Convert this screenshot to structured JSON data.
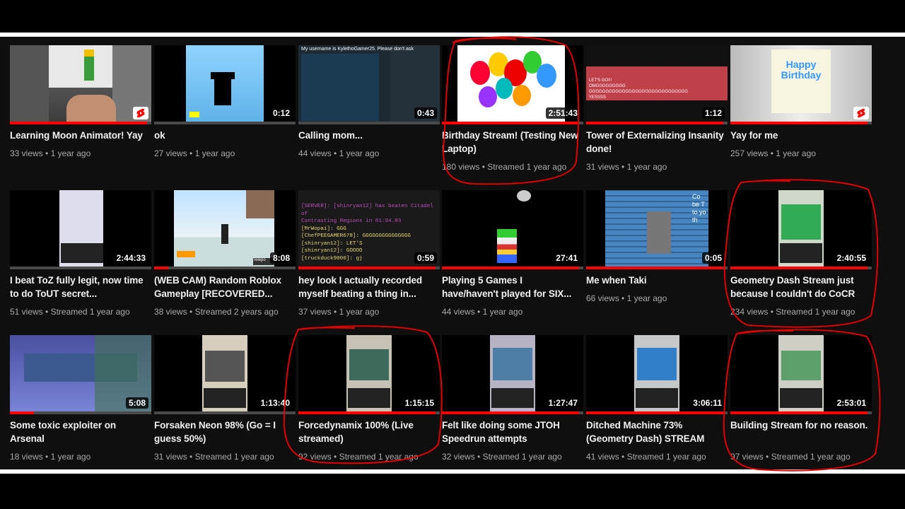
{
  "colors": {
    "accent": "#ff0000",
    "annotation": "#e00000",
    "background": "#0f0f0f"
  },
  "videos": [
    {
      "title": "Learning Moon Animator! Yay",
      "views": "33 views",
      "date": "1 year ago",
      "duration": "",
      "short": true,
      "progress": 0.97
    },
    {
      "title": "ok",
      "views": "27 views",
      "date": "1 year ago",
      "duration": "0:12",
      "short": false,
      "progress": 0.0
    },
    {
      "title": "Calling mom...",
      "views": "44 views",
      "date": "1 year ago",
      "duration": "0:43",
      "short": false,
      "progress": 0.0
    },
    {
      "title": "Birthday Stream! (Testing New Laptop)",
      "views": "180 views",
      "date": "Streamed 1 year ago",
      "duration": "2:51:43",
      "short": false,
      "progress": 0.97
    },
    {
      "title": "Tower of Externalizing Insanity done!",
      "views": "31 views",
      "date": "1 year ago",
      "duration": "1:12",
      "short": false,
      "progress": 0.97
    },
    {
      "title": "Yay for me",
      "views": "257 views",
      "date": "1 year ago",
      "duration": "",
      "short": true,
      "progress": 0.97
    },
    {
      "title": "I beat ToZ fully legit, now time to do ToUT secret...",
      "views": "51 views",
      "date": "Streamed 1 year ago",
      "duration": "2:44:33",
      "short": false,
      "progress": 0.0
    },
    {
      "title": "(WEB CAM) Random Roblox Gameplay [RECOVERED...",
      "views": "38 views",
      "date": "Streamed 2 years ago",
      "duration": "8:08",
      "short": false,
      "progress": 0.1
    },
    {
      "title": "hey look I actually recorded myself beating a thing in...",
      "views": "37 views",
      "date": "1 year ago",
      "duration": "0:59",
      "short": false,
      "progress": 0.97
    },
    {
      "title": "Playing 5 Games I have/haven't played for SIX...",
      "views": "44 views",
      "date": "1 year ago",
      "duration": "27:41",
      "short": false,
      "progress": 0.97
    },
    {
      "title": "Me when Taki",
      "views": "66 views",
      "date": "1 year ago",
      "duration": "0:05",
      "short": false,
      "progress": 0.97
    },
    {
      "title": "Geometry Dash Stream just because I couldn't do CoCR",
      "views": "234 views",
      "date": "Streamed 1 year ago",
      "duration": "2:40:55",
      "short": false,
      "progress": 0.97
    },
    {
      "title": "Some toxic exploiter on Arsenal",
      "views": "18 views",
      "date": "1 year ago",
      "duration": "5:08",
      "short": false,
      "progress": 0.17
    },
    {
      "title": "Forsaken Neon 98% (Go = I guess 50%)",
      "views": "31 views",
      "date": "Streamed 1 year ago",
      "duration": "1:13:40",
      "short": false,
      "progress": 0.0
    },
    {
      "title": "Forcedynamix 100% (Live streamed)",
      "views": "92 views",
      "date": "Streamed 1 year ago",
      "duration": "1:15:15",
      "short": false,
      "progress": 0.97
    },
    {
      "title": "Felt like doing some JTOH Speedrun attempts",
      "views": "32 views",
      "date": "Streamed 1 year ago",
      "duration": "1:27:47",
      "short": false,
      "progress": 0.97
    },
    {
      "title": "Ditched Machine 73% (Geometry Dash) STREAM",
      "views": "41 views",
      "date": "Streamed 1 year ago",
      "duration": "3:06:11",
      "short": false,
      "progress": 0.97
    },
    {
      "title": "Building Stream for no reason.",
      "views": "97 views",
      "date": "Streamed 1 year ago",
      "duration": "2:53:01",
      "short": false,
      "progress": 0.97
    }
  ],
  "thumb_text": {
    "calling_mom_username": "My username is KylethoGamer25. Please don't ask",
    "birthday_banner": "Happy Birthday",
    "tower_chat": [
      "LET'S GO!!!",
      "OMGGGGGGGGG",
      "GGGGGGGGGGGGGGGGGGGGGGGGGGGGGG",
      "YESSSS"
    ],
    "hey_look_chat": [
      "[SERVER]: [shinryan12] has beaten Citadel of",
      "Contrasting Regions in 61:04.83",
      "[MrWopai]: GGG",
      "[ChefPEEGAMER678]: GGGGGGGGGGGGGGG",
      "[shinryan12]: LET'S",
      "[shinryan12]: GOOOO",
      "[truckduck9000]: gj"
    ],
    "taki_side_text": "Co be T to yo th",
    "webcam_label": "Telepo"
  }
}
